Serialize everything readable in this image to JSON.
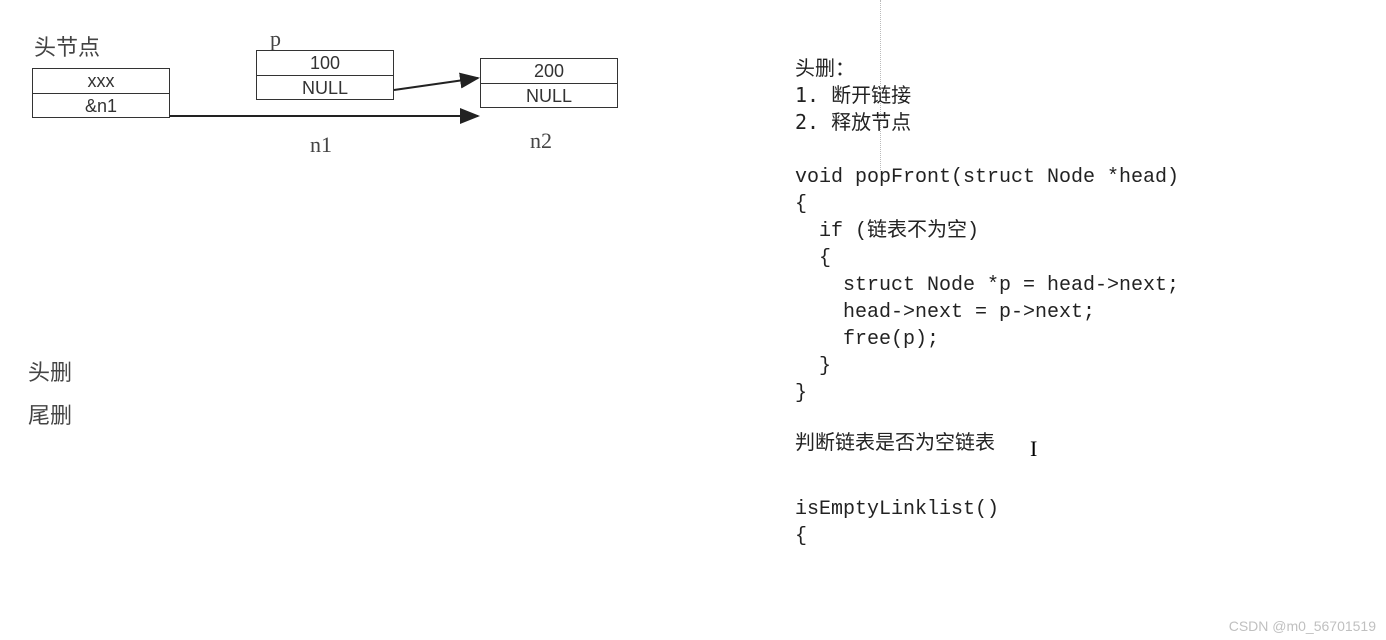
{
  "diagram": {
    "labels": {
      "head_node": "头节点",
      "p": "p",
      "n1": "n1",
      "n2": "n2",
      "head_delete": "头删",
      "tail_delete": "尾删"
    },
    "nodes": {
      "head": {
        "top": "xxx",
        "bottom": "&n1"
      },
      "n1": {
        "top": "100",
        "bottom": "NULL"
      },
      "n2": {
        "top": "200",
        "bottom": "NULL"
      }
    }
  },
  "right": {
    "title": "头删：",
    "step1": "1. 断开链接",
    "step2": "2. 释放节点",
    "code_l1": "void popFront(struct Node *head)",
    "code_l2": "{",
    "code_l3": "  if (链表不为空)",
    "code_l4": "  {",
    "code_l5": "    struct Node *p = head->next;",
    "code_l6": "",
    "code_l7": "    head->next = p->next;",
    "code_l8": "",
    "code_l9": "    free(p);",
    "code_l10": "  }",
    "code_l11": "}",
    "note": "判断链表是否为空链表",
    "fn_l1": "isEmptyLinklist()",
    "fn_l2": "{"
  },
  "watermark": "CSDN @m0_56701519"
}
